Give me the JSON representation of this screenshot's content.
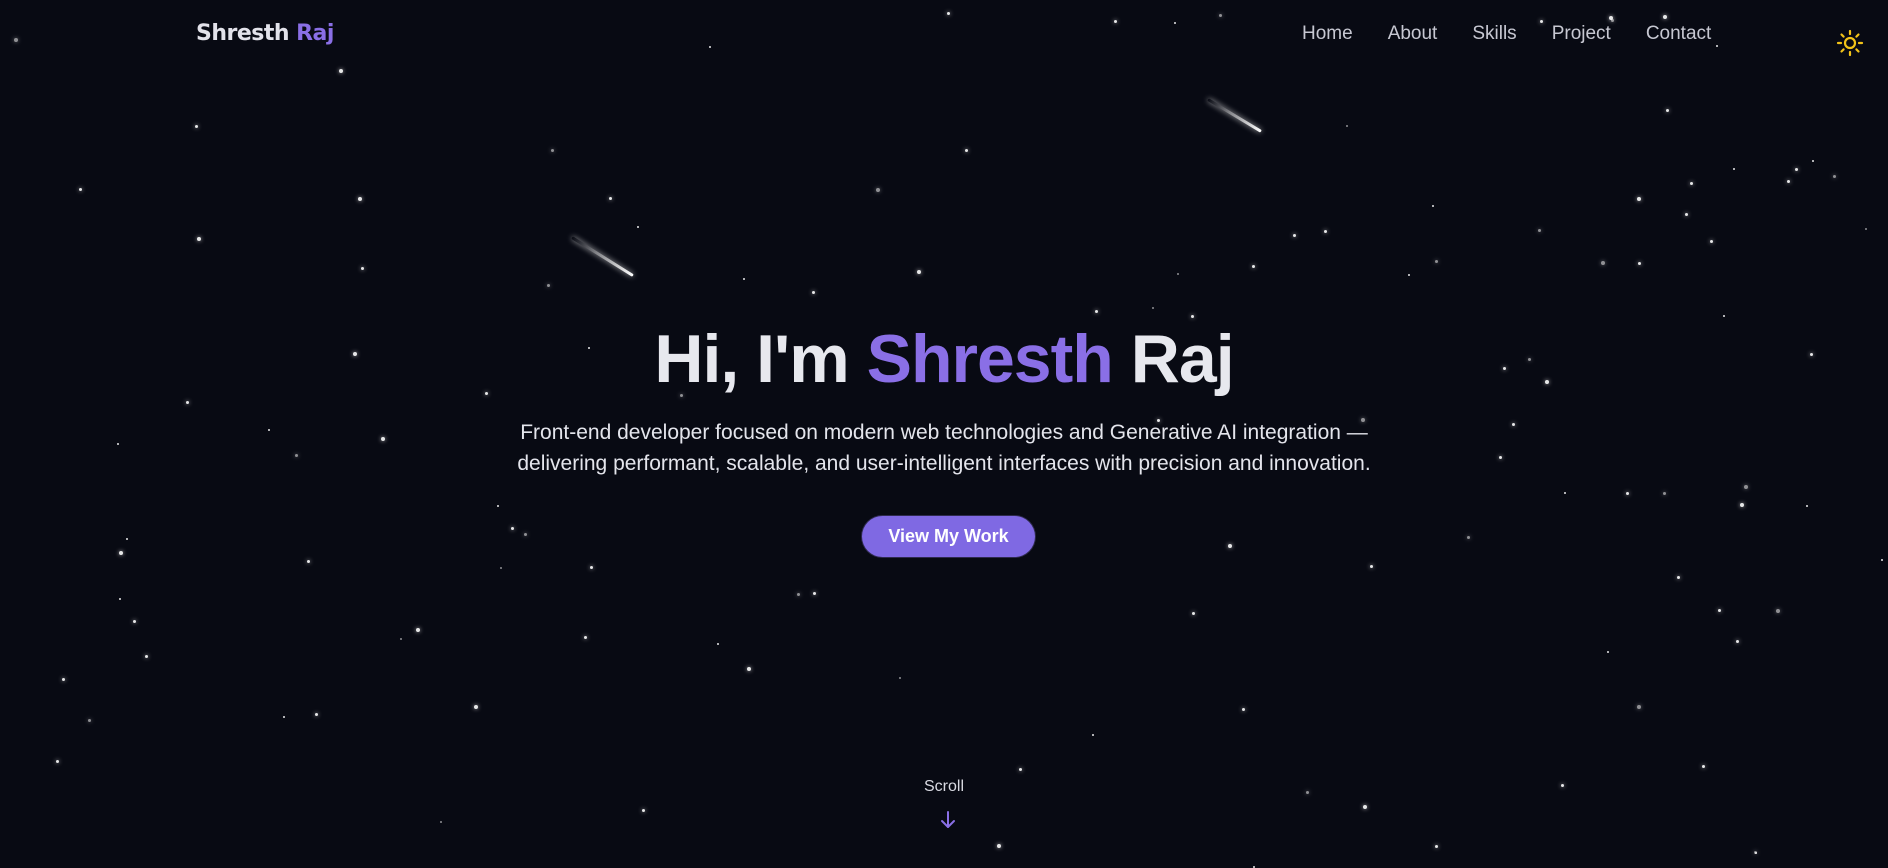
{
  "colors": {
    "background": "#080a13",
    "accent": "#8a6fe6",
    "button": "#7f69e3",
    "sun_icon": "#f2c318",
    "text": "#e7e8ee"
  },
  "navbar": {
    "logo_first": "Shresth",
    "logo_last": "Raj",
    "links": [
      "Home",
      "About",
      "Skills",
      "Project",
      "Contact"
    ],
    "theme_toggle_icon": "sun-icon"
  },
  "hero": {
    "greeting": "Hi, I'm",
    "first_name": "Shresth",
    "last_name": "Raj",
    "subtitle_line1": "Front-end developer focused on modern web technologies and Generative AI integration —",
    "subtitle_line2": "delivering performant, scalable, and user-intelligent interfaces with precision and innovation.",
    "cta_label": "View My Work"
  },
  "scroll": {
    "label": "Scroll",
    "icon": "arrow-down-icon"
  }
}
